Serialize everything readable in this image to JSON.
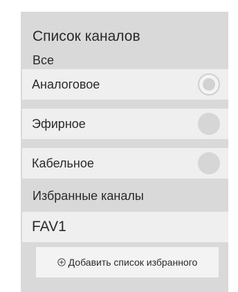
{
  "channel_panel": {
    "title": "Список каналов",
    "groups": {
      "all_label": "Все",
      "favorites_label": "Избранные каналы"
    },
    "channel_lists": [
      {
        "label": "Аналоговое",
        "selected": true
      },
      {
        "label": "Эфирное",
        "selected": false
      },
      {
        "label": "Кабельное",
        "selected": false
      }
    ],
    "favorite_lists": [
      {
        "label": "FAV1"
      }
    ],
    "add_favorites_button": {
      "label": "Добавить список избранного",
      "icon": "circled-plus-icon"
    }
  }
}
